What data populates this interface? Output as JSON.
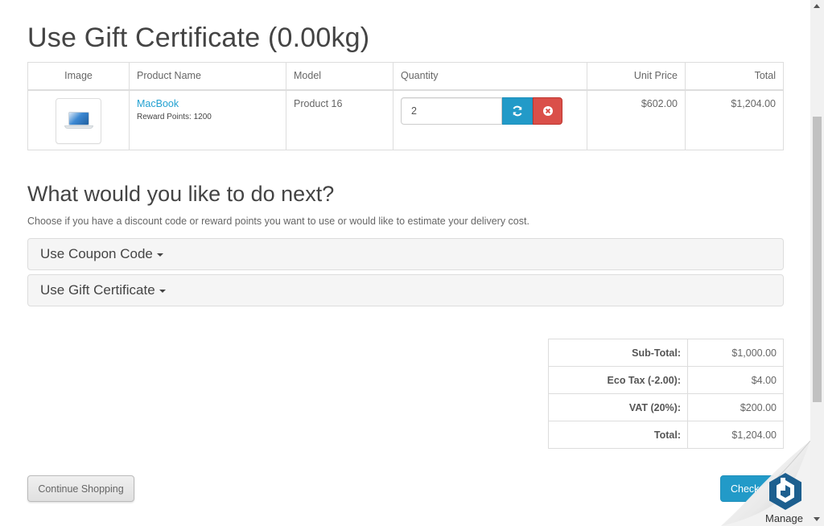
{
  "page": {
    "title": "Use Gift Certificate  (0.00kg)"
  },
  "cart": {
    "headers": {
      "image": "Image",
      "name": "Product Name",
      "model": "Model",
      "quantity": "Quantity",
      "unit_price": "Unit Price",
      "total": "Total"
    },
    "items": [
      {
        "name": "MacBook",
        "reward": "Reward Points: 1200",
        "model": "Product 16",
        "quantity": "2",
        "unit_price": "$602.00",
        "total": "$1,204.00"
      }
    ]
  },
  "next": {
    "title": "What would you like to do next?",
    "description": "Choose if you have a discount code or reward points you want to use or would like to estimate your delivery cost.",
    "panels": [
      {
        "label": "Use Coupon Code"
      },
      {
        "label": "Use Gift Certificate"
      }
    ]
  },
  "totals": [
    {
      "label": "Sub-Total:",
      "value": "$1,000.00"
    },
    {
      "label": "Eco Tax (-2.00):",
      "value": "$4.00"
    },
    {
      "label": "VAT (20%):",
      "value": "$200.00"
    },
    {
      "label": "Total:",
      "value": "$1,204.00"
    }
  ],
  "buttons": {
    "continue": "Continue Shopping",
    "checkout": "Checkout"
  },
  "badge": {
    "label": "Manage",
    "icon": "hexagon-logo-icon"
  },
  "colors": {
    "primary": "#229ac8",
    "danger": "#da4f49",
    "link": "#23a1d1"
  }
}
